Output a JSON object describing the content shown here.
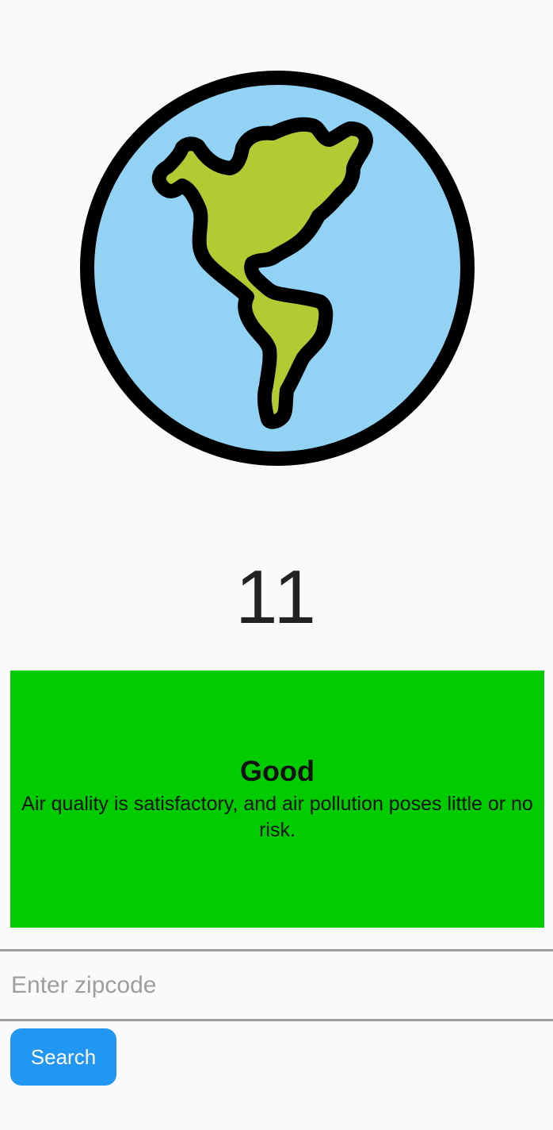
{
  "header_image": {
    "icon": "earth-americas-icon"
  },
  "aqi": {
    "value": "11"
  },
  "status": {
    "title": "Good",
    "description": "Air quality is satisfactory, and air pollution poses little or no risk.",
    "color": "#00cc00"
  },
  "search": {
    "placeholder": "Enter zipcode",
    "value": "",
    "button_label": "Search",
    "button_color": "#2196f3"
  },
  "colors": {
    "ocean": "#92d3f5",
    "land": "#b1cc33",
    "outline": "#000000",
    "background": "#fafafa"
  }
}
